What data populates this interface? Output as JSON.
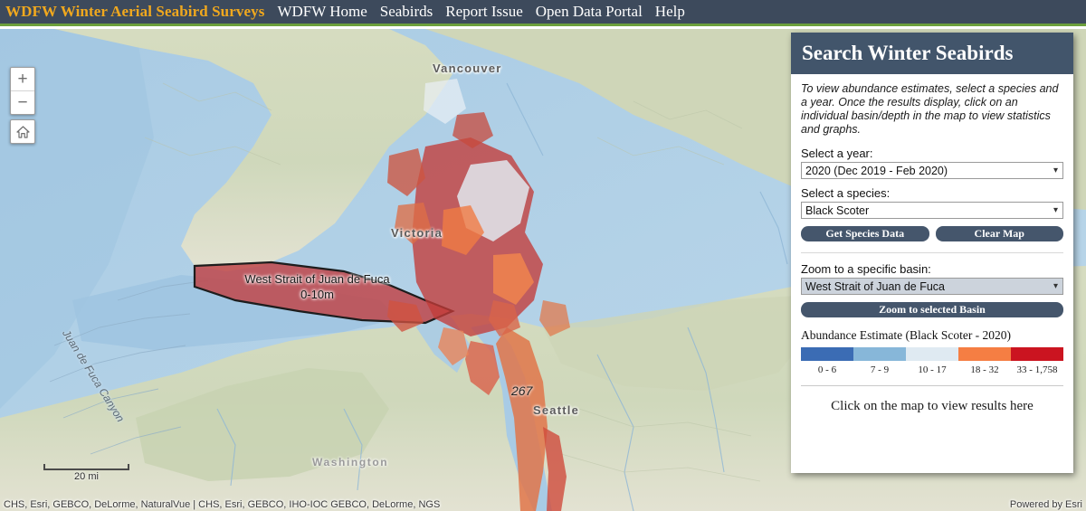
{
  "nav": {
    "brand": "WDFW Winter Aerial Seabird Surveys",
    "links": [
      {
        "label": "WDFW Home"
      },
      {
        "label": "Seabirds"
      },
      {
        "label": "Report Issue"
      },
      {
        "label": "Open Data Portal"
      },
      {
        "label": "Help"
      }
    ]
  },
  "map": {
    "controls": {
      "zoom_in": "+",
      "zoom_out": "−",
      "home_icon": "home-icon"
    },
    "scale": {
      "label": "20 mi"
    },
    "labels": {
      "vancouver": "Vancouver",
      "victoria": "Victoria",
      "seattle": "Seattle",
      "washington": "Washington",
      "juan_de_fuca_canyon": "Juan de Fuca Canyon",
      "selected_basin": "West Strait of Juan de Fuca 0-10m",
      "value_annotation": "267"
    },
    "attribution_left": "CHS, Esri, GEBCO, DeLorme, NaturalVue | CHS, Esri, GEBCO, IHO-IOC GEBCO, DeLorme, NGS",
    "attribution_right": "Powered by Esri"
  },
  "panel": {
    "title": "Search Winter Seabirds",
    "description": "To view abundance estimates, select a species and a year. Once the results display, click on an individual basin/depth in the map to view statistics and graphs.",
    "year_label": "Select a year:",
    "year_value": "2020 (Dec 2019 - Feb 2020)",
    "species_label": "Select a species:",
    "species_value": "Black Scoter",
    "get_species_data_label": "Get Species Data",
    "clear_map_label": "Clear Map",
    "basin_label": "Zoom to a specific basin:",
    "basin_value": "West Strait of Juan de Fuca",
    "zoom_basin_label": "Zoom to selected Basin",
    "results_placeholder": "Click on the map to view results here"
  },
  "legend": {
    "title": "Abundance Estimate (Black Scoter - 2020)",
    "classes": [
      {
        "label": "0 - 6",
        "color": "#3b6cb4"
      },
      {
        "label": "7 - 9",
        "color": "#87b7d9"
      },
      {
        "label": "10 - 17",
        "color": "#dfeaf2"
      },
      {
        "label": "18 - 32",
        "color": "#f57e43"
      },
      {
        "label": "33 - 1,758",
        "color": "#cb1420"
      }
    ]
  },
  "theme": {
    "navbar_bg": "#3d4a5c",
    "navbar_accent": "#6ca03c",
    "brand_color": "#f0a81e",
    "panel_header_bg": "#42556b",
    "button_bg": "#45566c"
  }
}
